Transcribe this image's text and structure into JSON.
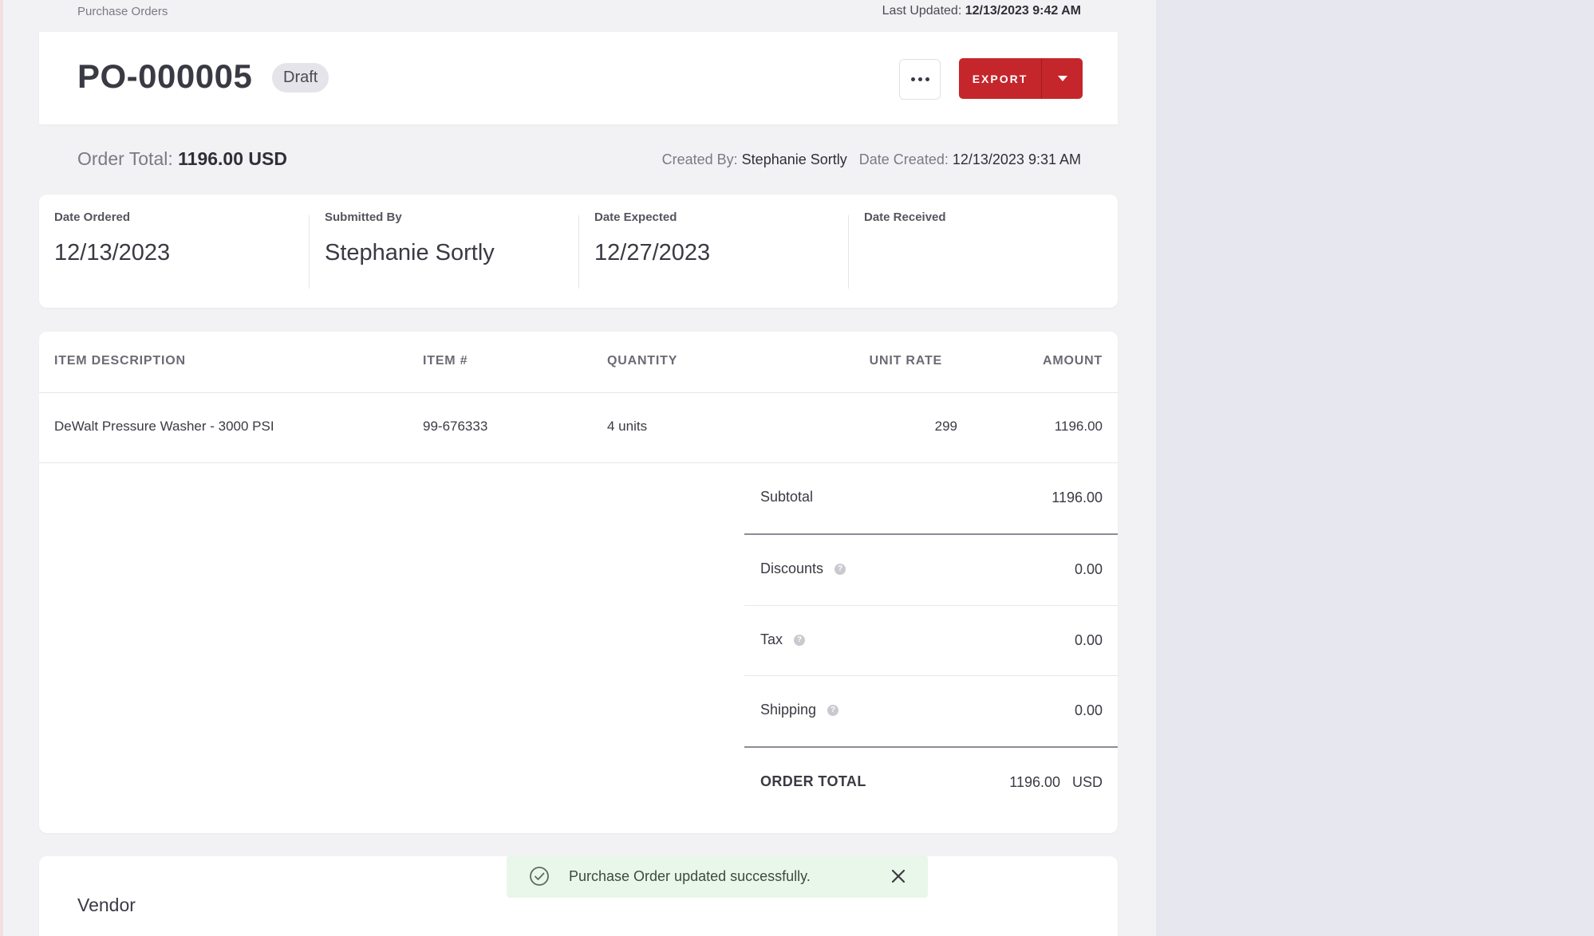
{
  "breadcrumb": "Purchase Orders",
  "last_updated": {
    "label": "Last Updated:",
    "value": "12/13/2023 9:42 AM"
  },
  "header": {
    "po_number": "PO-000005",
    "status": "Draft",
    "export_label": "EXPORT"
  },
  "summary": {
    "order_total_label": "Order Total:",
    "order_total_value": "1196.00 USD",
    "created_by_label": "Created By:",
    "created_by_value": "Stephanie Sortly",
    "date_created_label": "Date Created:",
    "date_created_value": "12/13/2023 9:31 AM"
  },
  "dates": [
    {
      "label": "Date Ordered",
      "value": "12/13/2023"
    },
    {
      "label": "Submitted By",
      "value": "Stephanie Sortly"
    },
    {
      "label": "Date Expected",
      "value": "12/27/2023"
    },
    {
      "label": "Date Received",
      "value": ""
    }
  ],
  "table": {
    "headers": {
      "description": "ITEM DESCRIPTION",
      "item_no": "ITEM #",
      "quantity": "QUANTITY",
      "unit_rate": "UNIT RATE",
      "amount": "AMOUNT"
    },
    "rows": [
      {
        "description": "DeWalt Pressure Washer - 3000 PSI",
        "item_no": "99-676333",
        "quantity": "4 units",
        "unit_rate": "299",
        "amount": "1196.00"
      }
    ]
  },
  "totals": {
    "subtotal_label": "Subtotal",
    "subtotal": "1196.00",
    "discounts_label": "Discounts",
    "discounts": "0.00",
    "tax_label": "Tax",
    "tax": "0.00",
    "shipping_label": "Shipping",
    "shipping": "0.00",
    "order_total_label": "ORDER TOTAL",
    "order_total": "1196.00",
    "currency": "USD"
  },
  "vendor": {
    "title": "Vendor"
  },
  "toast": {
    "message": "Purchase Order updated successfully."
  },
  "colors": {
    "accent": "#c4262b",
    "toast_bg": "#e9f6ea"
  }
}
